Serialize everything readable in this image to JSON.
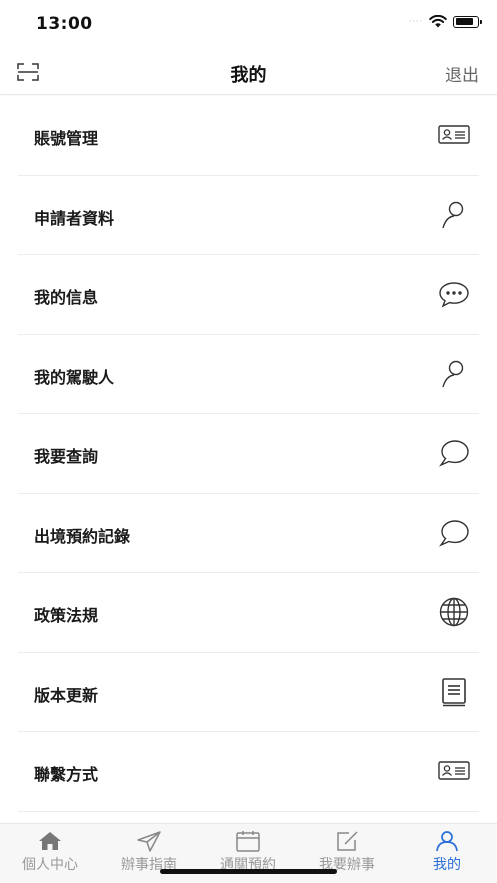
{
  "status_bar": {
    "time": "13:00",
    "signal": "····"
  },
  "nav": {
    "title": "我的",
    "logout_label": "退出"
  },
  "menu_items": [
    {
      "label": "賬號管理",
      "icon": "id-card-icon"
    },
    {
      "label": "申請者資料",
      "icon": "person-icon"
    },
    {
      "label": "我的信息",
      "icon": "chat-dots-icon"
    },
    {
      "label": "我的駕駛人",
      "icon": "person-icon"
    },
    {
      "label": "我要查詢",
      "icon": "chat-bubble-icon"
    },
    {
      "label": "出境預約記錄",
      "icon": "chat-bubble-icon"
    },
    {
      "label": "政策法規",
      "icon": "globe-icon"
    },
    {
      "label": "版本更新",
      "icon": "document-icon"
    },
    {
      "label": "聯繫方式",
      "icon": "id-card-icon"
    }
  ],
  "tabs": [
    {
      "label": "個人中心",
      "icon": "home-icon",
      "active": false
    },
    {
      "label": "辦事指南",
      "icon": "send-icon",
      "active": false
    },
    {
      "label": "通關預約",
      "icon": "calendar-icon",
      "active": false
    },
    {
      "label": "我要辦事",
      "icon": "edit-icon",
      "active": false
    },
    {
      "label": "我的",
      "icon": "person-icon",
      "active": true
    }
  ],
  "colors": {
    "accent": "#2a6fd8",
    "tab_inactive": "#999999",
    "text": "#1a1a1a"
  }
}
